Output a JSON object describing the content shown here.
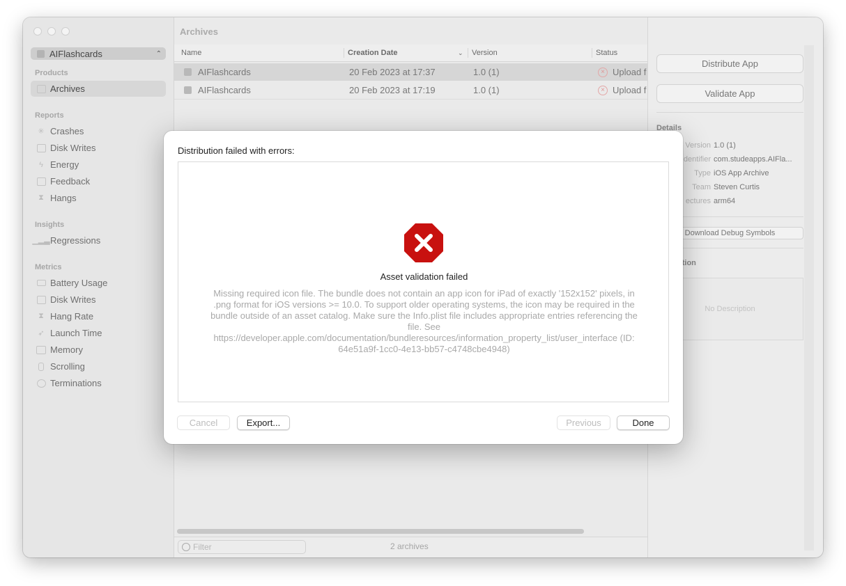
{
  "sidebar": {
    "scheme": "AIFlashcards",
    "sections": [
      {
        "title": "Products",
        "items": [
          "Archives"
        ]
      },
      {
        "title": "Reports",
        "items": [
          "Crashes",
          "Disk Writes",
          "Energy",
          "Feedback",
          "Hangs"
        ]
      },
      {
        "title": "Insights",
        "items": [
          "Regressions"
        ]
      },
      {
        "title": "Metrics",
        "items": [
          "Battery Usage",
          "Disk Writes",
          "Hang Rate",
          "Launch Time",
          "Memory",
          "Scrolling",
          "Terminations"
        ]
      }
    ]
  },
  "main": {
    "title": "Archives",
    "columns": [
      "Name",
      "Creation Date",
      "Version",
      "Status"
    ],
    "rows": [
      {
        "name": "AIFlashcards",
        "date": "20 Feb 2023 at 17:37",
        "version": "1.0 (1)",
        "status": "Upload f"
      },
      {
        "name": "AIFlashcards",
        "date": "20 Feb 2023 at 17:19",
        "version": "1.0 (1)",
        "status": "Upload f"
      }
    ],
    "filter_placeholder": "Filter",
    "count": "2 archives"
  },
  "inspector": {
    "distribute": "Distribute App",
    "validate": "Validate App",
    "details_title": "Details",
    "details": [
      {
        "label": "Version",
        "value": "1.0 (1)"
      },
      {
        "label": "dentifier",
        "value": "com.studeapps.AIFla..."
      },
      {
        "label": "Type",
        "value": "iOS App Archive"
      },
      {
        "label": "Team",
        "value": "Steven Curtis"
      },
      {
        "label": "ectures",
        "value": "arm64"
      }
    ],
    "debug_symbols": "Download Debug Symbols",
    "description_title": "ption",
    "no_description": "No Description"
  },
  "sheet": {
    "title": "Distribution failed with errors:",
    "error_title": "Asset validation failed",
    "error_body": "Missing required icon file. The bundle does not contain an app icon for iPad of exactly '152x152' pixels, in .png format for iOS versions >= 10.0. To support older operating systems, the icon may be required in the bundle outside of an asset catalog. Make sure the Info.plist file includes appropriate entries referencing the file. See https://developer.apple.com/documentation/bundleresources/information_property_list/user_interface (ID: 64e51a9f-1cc0-4e13-bb57-c4748cbe4948)",
    "cancel": "Cancel",
    "export": "Export...",
    "previous": "Previous",
    "done": "Done"
  },
  "colors": {
    "error_red": "#c8110f",
    "accent_selection": "#d6d6d6"
  }
}
